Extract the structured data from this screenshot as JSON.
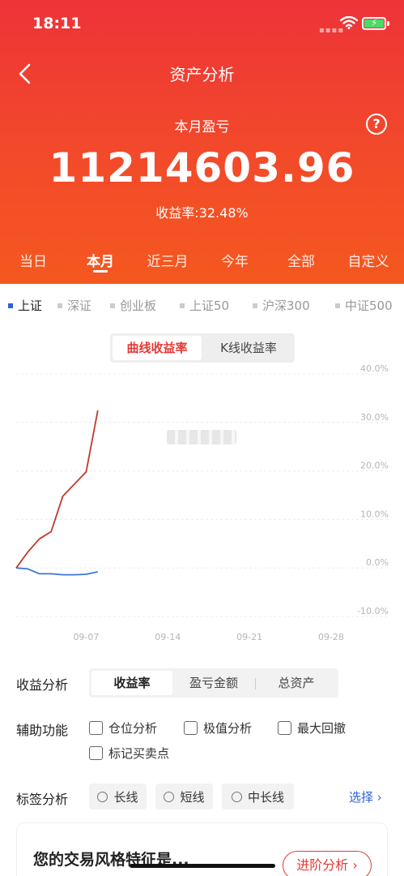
{
  "status": {
    "time": "18:11"
  },
  "header": {
    "title": "资产分析",
    "summary_label": "本月盈亏",
    "amount": "11214603.96",
    "yield": "收益率:32.48%",
    "help": "?"
  },
  "period_tabs": [
    {
      "label": "当日",
      "active": false
    },
    {
      "label": "本月",
      "active": true
    },
    {
      "label": "近三月",
      "active": false
    },
    {
      "label": "今年",
      "active": false
    },
    {
      "label": "全部",
      "active": false
    },
    {
      "label": "自定义",
      "active": false
    }
  ],
  "index_options": [
    {
      "label": "上证",
      "active": true
    },
    {
      "label": "深证",
      "active": false
    },
    {
      "label": "创业板",
      "active": false
    },
    {
      "label": "上证50",
      "active": false
    },
    {
      "label": "沪深300",
      "active": false
    },
    {
      "label": "中证500",
      "active": false
    }
  ],
  "chart_toggle": {
    "curve": "曲线收益率",
    "kline": "K线收益率"
  },
  "chart_data": {
    "type": "line",
    "x_tick_labels": [
      "09-07",
      "09-14",
      "09-21",
      "09-28"
    ],
    "y_tick_labels": [
      "40.0%",
      "30.0%",
      "20.0%",
      "10.0%",
      "0.0%",
      "-10.0%"
    ],
    "ylim": [
      -10,
      40
    ],
    "series": [
      {
        "color": "#c0392b",
        "x": [
          "09-01",
          "09-02",
          "09-03",
          "09-04",
          "09-05",
          "09-06",
          "09-07",
          "09-08"
        ],
        "values": [
          0.0,
          3.3,
          6.0,
          7.5,
          14.8,
          17.3,
          19.8,
          32.48
        ]
      },
      {
        "color": "#3f74d6",
        "x": [
          "09-01",
          "09-02",
          "09-03",
          "09-04",
          "09-05",
          "09-06",
          "09-07",
          "09-08"
        ],
        "values": [
          0.0,
          -0.2,
          -1.2,
          -1.2,
          -1.4,
          -1.4,
          -1.3,
          -0.8
        ]
      }
    ],
    "grid": true
  },
  "income_analysis": {
    "label": "收益分析",
    "options": [
      "收益率",
      "盈亏金额",
      "总资产"
    ],
    "selected": "收益率"
  },
  "aux": {
    "label": "辅助功能",
    "options": [
      "仓位分析",
      "极值分析",
      "最大回撤",
      "标记买卖点"
    ]
  },
  "tags": {
    "label": "标签分析",
    "options": [
      "长线",
      "短线",
      "中长线"
    ],
    "select_link": "选择 ›"
  },
  "style_card": {
    "title": "您的交易风格特征是...",
    "button": "进阶分析 ›"
  },
  "colors": {
    "brand_red": "#ee3338",
    "accent_blue": "#2b62d9"
  }
}
